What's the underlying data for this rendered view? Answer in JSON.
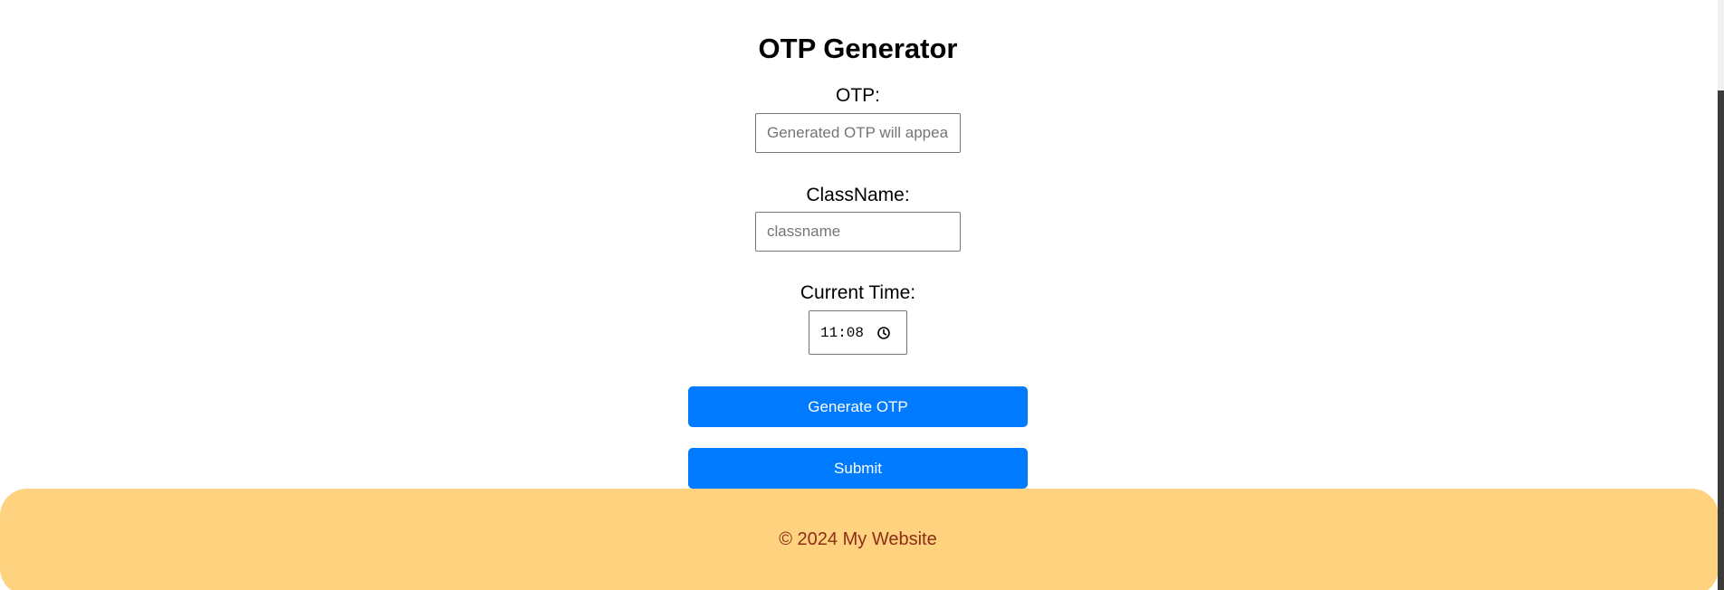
{
  "page": {
    "title": "OTP Generator"
  },
  "form": {
    "otp": {
      "label": "OTP:",
      "value": "",
      "placeholder": "Generated OTP will appear here"
    },
    "classname": {
      "label": "ClassName:",
      "value": "",
      "placeholder": "classname"
    },
    "current_time": {
      "label": "Current Time:",
      "value": "11:08",
      "icon": "clock-icon"
    }
  },
  "buttons": {
    "generate_label": "Generate OTP",
    "submit_label": "Submit"
  },
  "footer": {
    "text": "© 2024 My Website"
  },
  "colors": {
    "button_bg": "#007bff",
    "button_text": "#ffffff",
    "footer_bg": "#ffd280",
    "footer_text": "#8b2e16"
  }
}
